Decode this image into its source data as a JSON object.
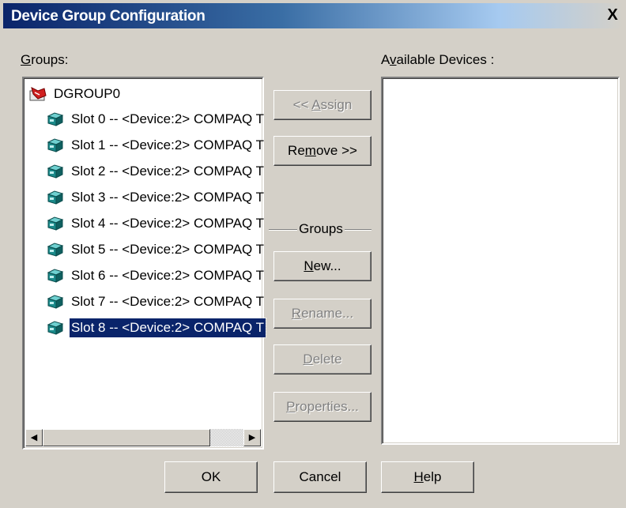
{
  "window": {
    "title": "Device Group Configuration",
    "close_glyph": "X"
  },
  "groups_label": {
    "mnemonic": "G",
    "rest": "roups:"
  },
  "devices_label": {
    "pre": "A",
    "mnemonic": "v",
    "rest": "ailable Devices :"
  },
  "groups_tree": {
    "root": {
      "label": "DGROUP0",
      "icon": "group-folder-icon"
    },
    "items": [
      {
        "label": "Slot 0 -- <Device:2> COMPAQ T",
        "icon": "tape-device-icon"
      },
      {
        "label": "Slot 1 -- <Device:2> COMPAQ T",
        "icon": "tape-device-icon"
      },
      {
        "label": "Slot 2 -- <Device:2> COMPAQ T",
        "icon": "tape-device-icon"
      },
      {
        "label": "Slot 3 -- <Device:2> COMPAQ T",
        "icon": "tape-device-icon"
      },
      {
        "label": "Slot 4 -- <Device:2> COMPAQ T",
        "icon": "tape-device-icon"
      },
      {
        "label": "Slot 5 -- <Device:2> COMPAQ T",
        "icon": "tape-device-icon"
      },
      {
        "label": "Slot 6 -- <Device:2> COMPAQ T",
        "icon": "tape-device-icon"
      },
      {
        "label": "Slot 7 -- <Device:2> COMPAQ T",
        "icon": "tape-device-icon"
      },
      {
        "label": "Slot 8 -- <Device:2> COMPAQ T",
        "icon": "tape-device-icon",
        "selected": true
      }
    ]
  },
  "buttons": {
    "assign": {
      "pre": "<< ",
      "mnemonic": "A",
      "rest": "ssign",
      "enabled": false
    },
    "remove": {
      "pre": "Re",
      "mnemonic": "m",
      "rest": "ove >>",
      "enabled": true
    },
    "groups_section": "Groups",
    "new": {
      "pre": "",
      "mnemonic": "N",
      "rest": "ew...",
      "enabled": true
    },
    "rename": {
      "pre": "",
      "mnemonic": "R",
      "rest": "ename...",
      "enabled": false
    },
    "delete": {
      "pre": "",
      "mnemonic": "D",
      "rest": "elete",
      "enabled": false
    },
    "properties": {
      "pre": "",
      "mnemonic": "P",
      "rest": "roperties...",
      "enabled": false
    },
    "ok": "OK",
    "cancel": "Cancel",
    "help": {
      "pre": "",
      "mnemonic": "H",
      "rest": "elp"
    }
  },
  "scrollbar": {
    "left_arrow": "◀",
    "right_arrow": "▶"
  },
  "colors": {
    "selection": "#0a246a",
    "title_start": "#0a246a",
    "face": "#d4d0c8",
    "icon_teal": "#1a8a8a"
  }
}
